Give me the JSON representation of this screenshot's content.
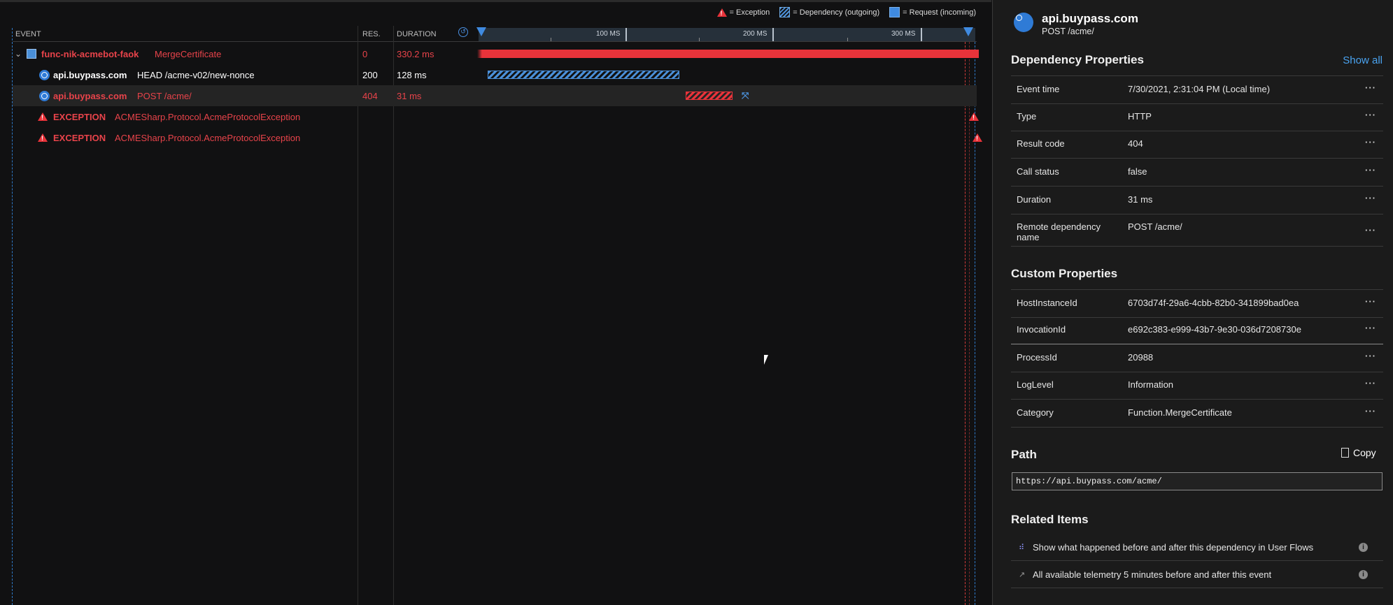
{
  "legend": {
    "exception": "= Exception",
    "dependency": "= Dependency (outgoing)",
    "request": "= Request (incoming)"
  },
  "columns": {
    "event": "EVENT",
    "res": "RES.",
    "duration": "DURATION"
  },
  "axis": {
    "t100": "100 MS",
    "t200": "200 MS",
    "t300": "300 MS"
  },
  "rows": [
    {
      "name": "func-nik-acmebot-faok",
      "detail": "MergeCertificate",
      "res": "0",
      "duration": "330.2 ms"
    },
    {
      "name": "api.buypass.com",
      "detail": "HEAD /acme-v02/new-nonce",
      "res": "200",
      "duration": "128 ms"
    },
    {
      "name": "api.buypass.com",
      "detail": "POST /acme/",
      "res": "404",
      "duration": "31 ms"
    },
    {
      "name": "EXCEPTION",
      "detail": "ACMESharp.Protocol.AcmeProtocolException"
    },
    {
      "name": "EXCEPTION",
      "detail": "ACMESharp.Protocol.AcmeProtocolException"
    }
  ],
  "panel": {
    "title": "api.buypass.com",
    "subtitle": "POST /acme/",
    "dep_section": "Dependency Properties",
    "show_all": "Show all",
    "dep_props": [
      {
        "k": "Event time",
        "v": "7/30/2021, 2:31:04 PM (Local time)"
      },
      {
        "k": "Type",
        "v": "HTTP"
      },
      {
        "k": "Result code",
        "v": "404"
      },
      {
        "k": "Call status",
        "v": "false"
      },
      {
        "k": "Duration",
        "v": "31 ms"
      },
      {
        "k": "Remote dependency name",
        "v": "POST /acme/"
      }
    ],
    "custom_section": "Custom Properties",
    "custom_props": [
      {
        "k": "HostInstanceId",
        "v": "6703d74f-29a6-4cbb-82b0-341899bad0ea"
      },
      {
        "k": "InvocationId",
        "v": "e692c383-e999-43b7-9e30-036d7208730e"
      },
      {
        "k": "ProcessId",
        "v": "20988"
      },
      {
        "k": "LogLevel",
        "v": "Information"
      },
      {
        "k": "Category",
        "v": "Function.MergeCertificate"
      }
    ],
    "more": "···",
    "path_section": "Path",
    "copy": "Copy",
    "path_value": "https://api.buypass.com/acme/",
    "related_section": "Related Items",
    "related": [
      "Show what happened before and after this dependency in User Flows",
      "All available telemetry 5 minutes before and after this event"
    ]
  }
}
